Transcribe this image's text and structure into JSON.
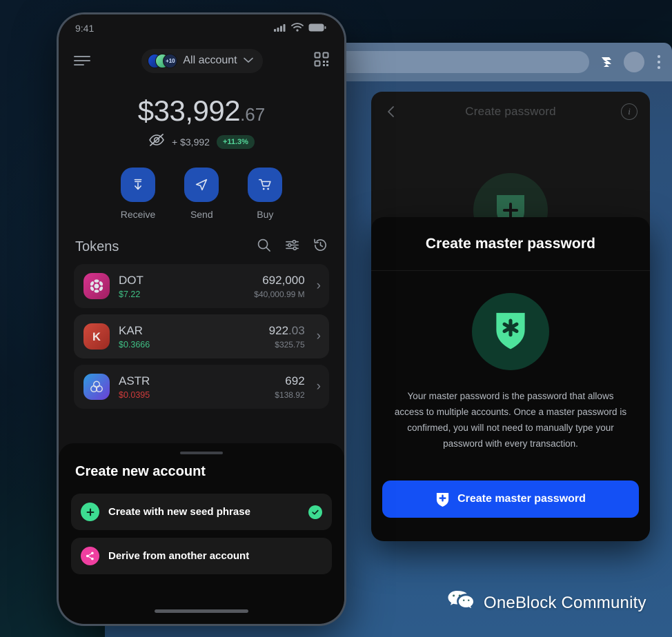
{
  "browser": {
    "omnibox_value": "",
    "omnibox_placeholder": "",
    "extension_icon": "subwallet-extension-icon",
    "avatar_icon": "profile-avatar-icon",
    "menu_icon": "kebab-menu-icon"
  },
  "page_card": {
    "back_icon": "chevron-left-icon",
    "title": "Create password",
    "info_icon": "info-icon",
    "info_glyph": "i",
    "ghost_icon": "shield-plus-icon"
  },
  "modal": {
    "title": "Create master password",
    "shield_icon": "shield-asterisk-icon",
    "description": "Your master password is the password that allows access to multiple accounts. Once a master password is confirmed, you will not need to manually type your password with every transaction.",
    "cta_label": "Create master password",
    "cta_icon": "shield-plus-icon",
    "cta_color": "#1450f5"
  },
  "phone": {
    "status_bar": {
      "time": "9:41",
      "signal_icon": "cellular-signal-icon",
      "wifi_icon": "wifi-icon",
      "battery_icon": "battery-full-icon"
    },
    "app_bar": {
      "menu_icon": "hamburger-menu-icon",
      "account_label": "All account",
      "account_badge": "+10",
      "chevron_icon": "chevron-down-icon",
      "scan_icon": "qr-scan-icon"
    },
    "balance": {
      "whole": "$33,992",
      "cents": ".67",
      "hide_icon": "eye-off-icon",
      "change": "+ $3,992",
      "percent": "+11.3%",
      "percent_color": "#54d79a"
    },
    "actions": [
      {
        "label": "Receive",
        "icon": "receive-download-icon"
      },
      {
        "label": "Send",
        "icon": "send-paper-plane-icon"
      },
      {
        "label": "Buy",
        "icon": "buy-cart-icon"
      }
    ],
    "tokens_section": {
      "title": "Tokens",
      "tools": [
        {
          "icon": "search-icon"
        },
        {
          "icon": "filter-sliders-icon"
        },
        {
          "icon": "history-clock-icon"
        }
      ]
    },
    "tokens": [
      {
        "symbol": "DOT",
        "price": "$7.22",
        "price_color": "#3fbf84",
        "amount_whole": "692,000",
        "amount_dec": "",
        "value": "$40,000.99 M",
        "icon": "polkadot-token-icon",
        "icon_color": "#c72d7f",
        "chevron": "chevron-right-icon"
      },
      {
        "symbol": "KAR",
        "price": "$0.3666",
        "price_color": "#3fbf84",
        "amount_whole": "922",
        "amount_dec": ".03",
        "value": "$325.75",
        "icon": "karura-token-icon",
        "icon_color": "#c0392f",
        "chevron": "chevron-right-icon"
      },
      {
        "symbol": "ASTR",
        "price": "$0.0395",
        "price_color": "#cf3b3b",
        "amount_whole": "692",
        "amount_dec": "",
        "value": "$138.92",
        "icon": "astar-token-icon",
        "icon_color": "#3b6fd4",
        "chevron": "chevron-right-icon"
      }
    ],
    "sheet": {
      "title": "Create new account",
      "options": [
        {
          "label": "Create with new seed phrase",
          "icon": "plus-circle-icon",
          "icon_color": "#3ddc91",
          "selected": true,
          "check_icon": "check-circle-icon"
        },
        {
          "label": "Derive from another account",
          "icon": "share-nodes-icon",
          "icon_color": "#ef3fa0",
          "selected": false,
          "check_icon": ""
        }
      ]
    }
  },
  "watermark": {
    "icon": "wechat-icon",
    "text": "OneBlock Community"
  }
}
